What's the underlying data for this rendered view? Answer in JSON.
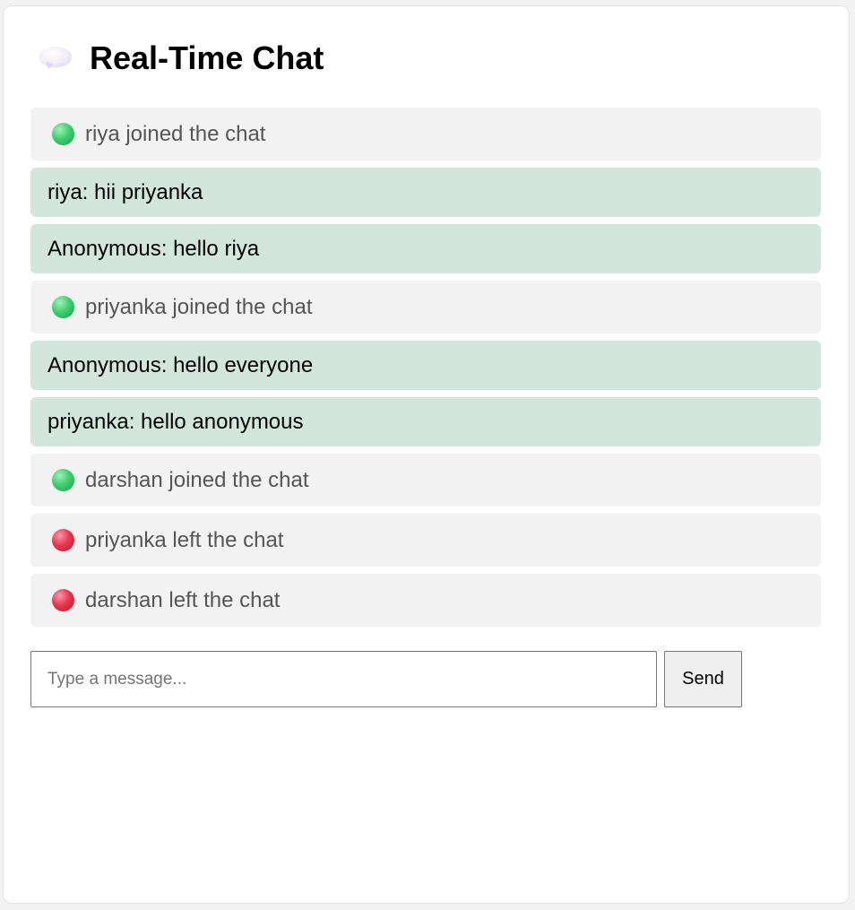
{
  "header": {
    "icon": "speech-bubble-icon",
    "title": "Real-Time Chat"
  },
  "messages": [
    {
      "type": "system",
      "status": "joined",
      "text": "riya joined the chat"
    },
    {
      "type": "chat",
      "text": "riya: hii priyanka"
    },
    {
      "type": "chat",
      "text": "Anonymous: hello riya"
    },
    {
      "type": "system",
      "status": "joined",
      "text": "priyanka joined the chat"
    },
    {
      "type": "chat",
      "text": "Anonymous: hello everyone"
    },
    {
      "type": "chat",
      "text": "priyanka: hello anonymous"
    },
    {
      "type": "system",
      "status": "joined",
      "text": "darshan joined the chat"
    },
    {
      "type": "system",
      "status": "left",
      "text": "priyanka left the chat"
    },
    {
      "type": "system",
      "status": "left",
      "text": "darshan left the chat"
    }
  ],
  "composer": {
    "value": "",
    "placeholder": "Type a message...",
    "send_label": "Send"
  },
  "colors": {
    "system_bg": "#f2f2f2",
    "chat_bg": "#d2e6de",
    "joined_dot": "#3fcf6f",
    "left_dot": "#e8364f"
  }
}
